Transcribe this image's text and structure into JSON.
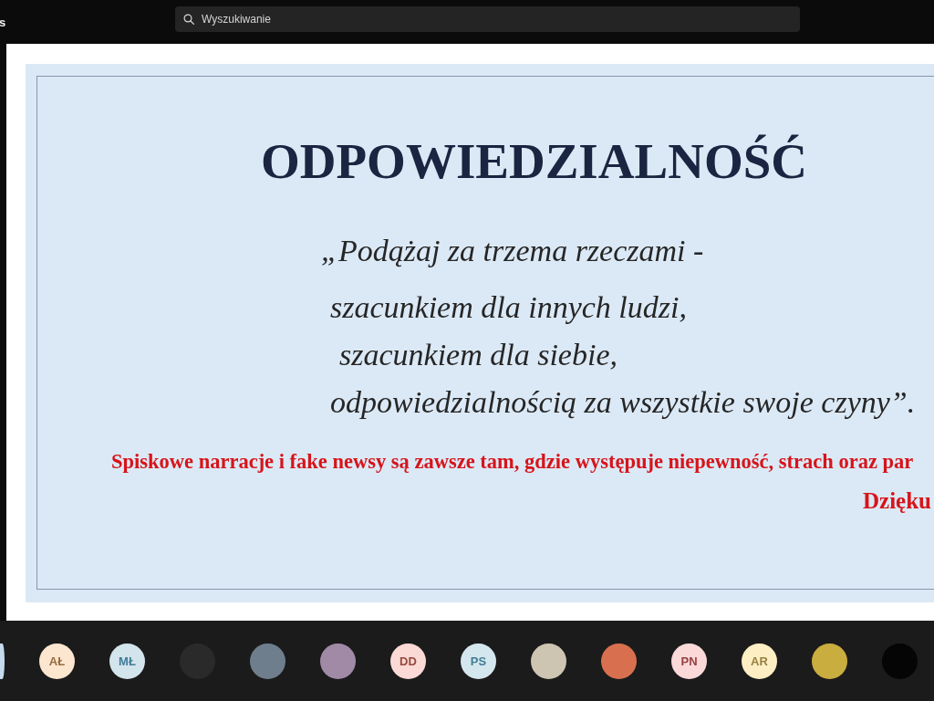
{
  "top_bar": {
    "app_title": "s",
    "search": {
      "placeholder": "Wyszukiwanie"
    }
  },
  "slide": {
    "title": "ODPOWIEDZIALNOŚĆ",
    "quote_lines": [
      "„Podążaj za trzema rzeczami -",
      "szacunkiem dla innych ludzi,",
      "szacunkiem dla siebie,",
      "odpowiedzialnością za wszystkie swoje czyny”."
    ],
    "note": "Spiskowe narracje i fake newsy są zawsze tam, gdzie występuje niepewność, strach oraz par",
    "closing": "Dzięku"
  },
  "participants": [
    {
      "kind": "clipped",
      "color": "#c6daee"
    },
    {
      "kind": "initials",
      "initials": "AŁ",
      "color": "#fde6cf"
    },
    {
      "kind": "initials",
      "initials": "MŁ",
      "color": "#d3e4ec"
    },
    {
      "kind": "photo",
      "color": "#2a2a2a"
    },
    {
      "kind": "photo",
      "color": "#6f7e8c"
    },
    {
      "kind": "photo",
      "color": "#a08aa6"
    },
    {
      "kind": "initials",
      "initials": "DD",
      "color": "#fbd9d5"
    },
    {
      "kind": "initials",
      "initials": "PS",
      "color": "#d5e7ee"
    },
    {
      "kind": "photo",
      "color": "#cdc4b2"
    },
    {
      "kind": "photo",
      "color": "#d8704f"
    },
    {
      "kind": "initials",
      "initials": "PN",
      "color": "#fcd9d9"
    },
    {
      "kind": "initials",
      "initials": "AR",
      "color": "#fdeec4"
    },
    {
      "kind": "photo",
      "color": "#c9ad3e"
    },
    {
      "kind": "photo",
      "color": "#050505"
    }
  ]
}
